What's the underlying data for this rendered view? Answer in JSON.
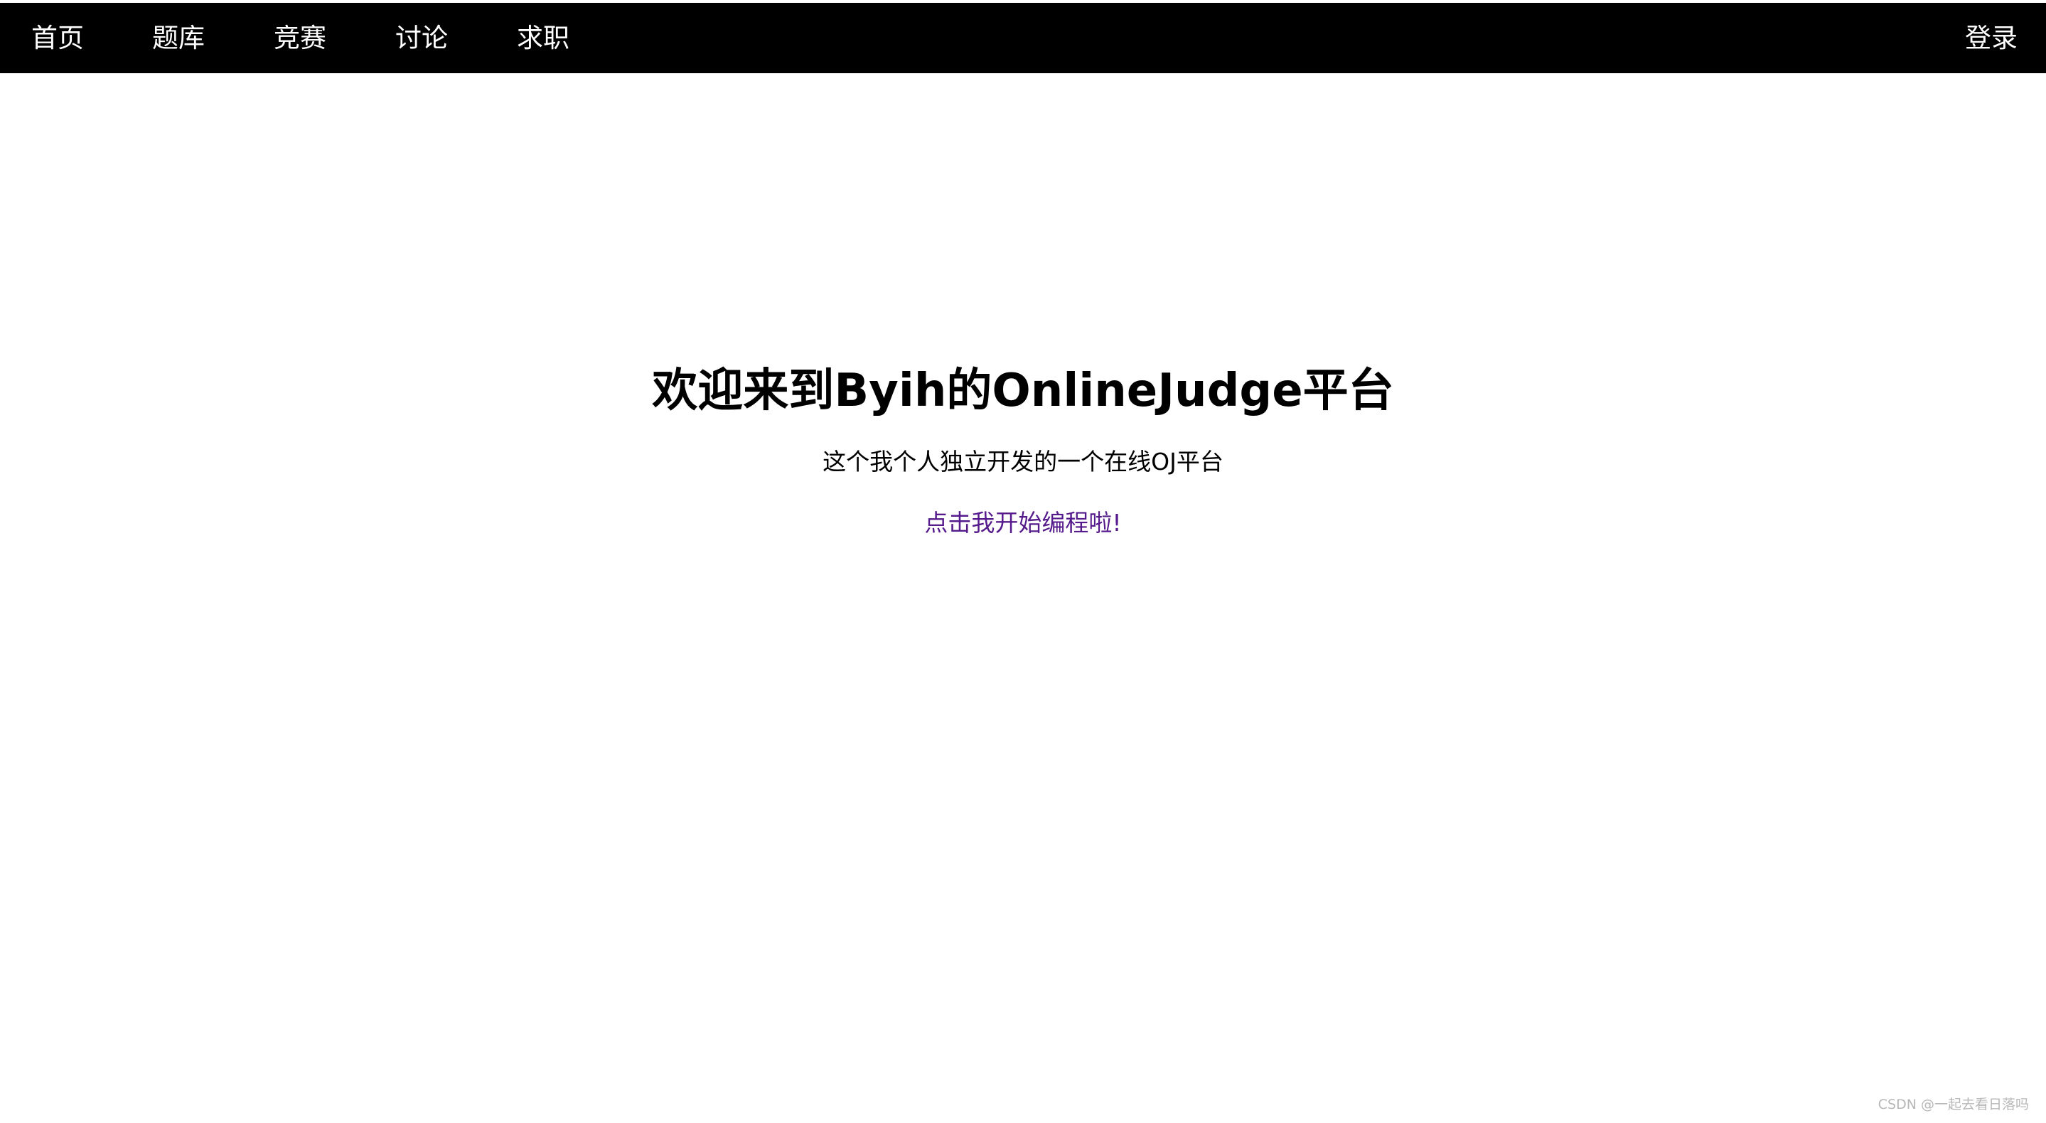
{
  "nav": {
    "items": [
      {
        "label": "首页"
      },
      {
        "label": "题库"
      },
      {
        "label": "竞赛"
      },
      {
        "label": "讨论"
      },
      {
        "label": "求职"
      }
    ],
    "login_label": "登录"
  },
  "hero": {
    "title": "欢迎来到Byih的OnlineJudge平台",
    "subtitle": "这个我个人独立开发的一个在线OJ平台",
    "cta_link": "点击我开始编程啦!"
  },
  "watermark": "CSDN @一起去看日落吗",
  "colors": {
    "navbar_background": "#000000",
    "nav_text": "#ffffff",
    "link_visited": "#551a8b",
    "page_background": "#ffffff"
  }
}
